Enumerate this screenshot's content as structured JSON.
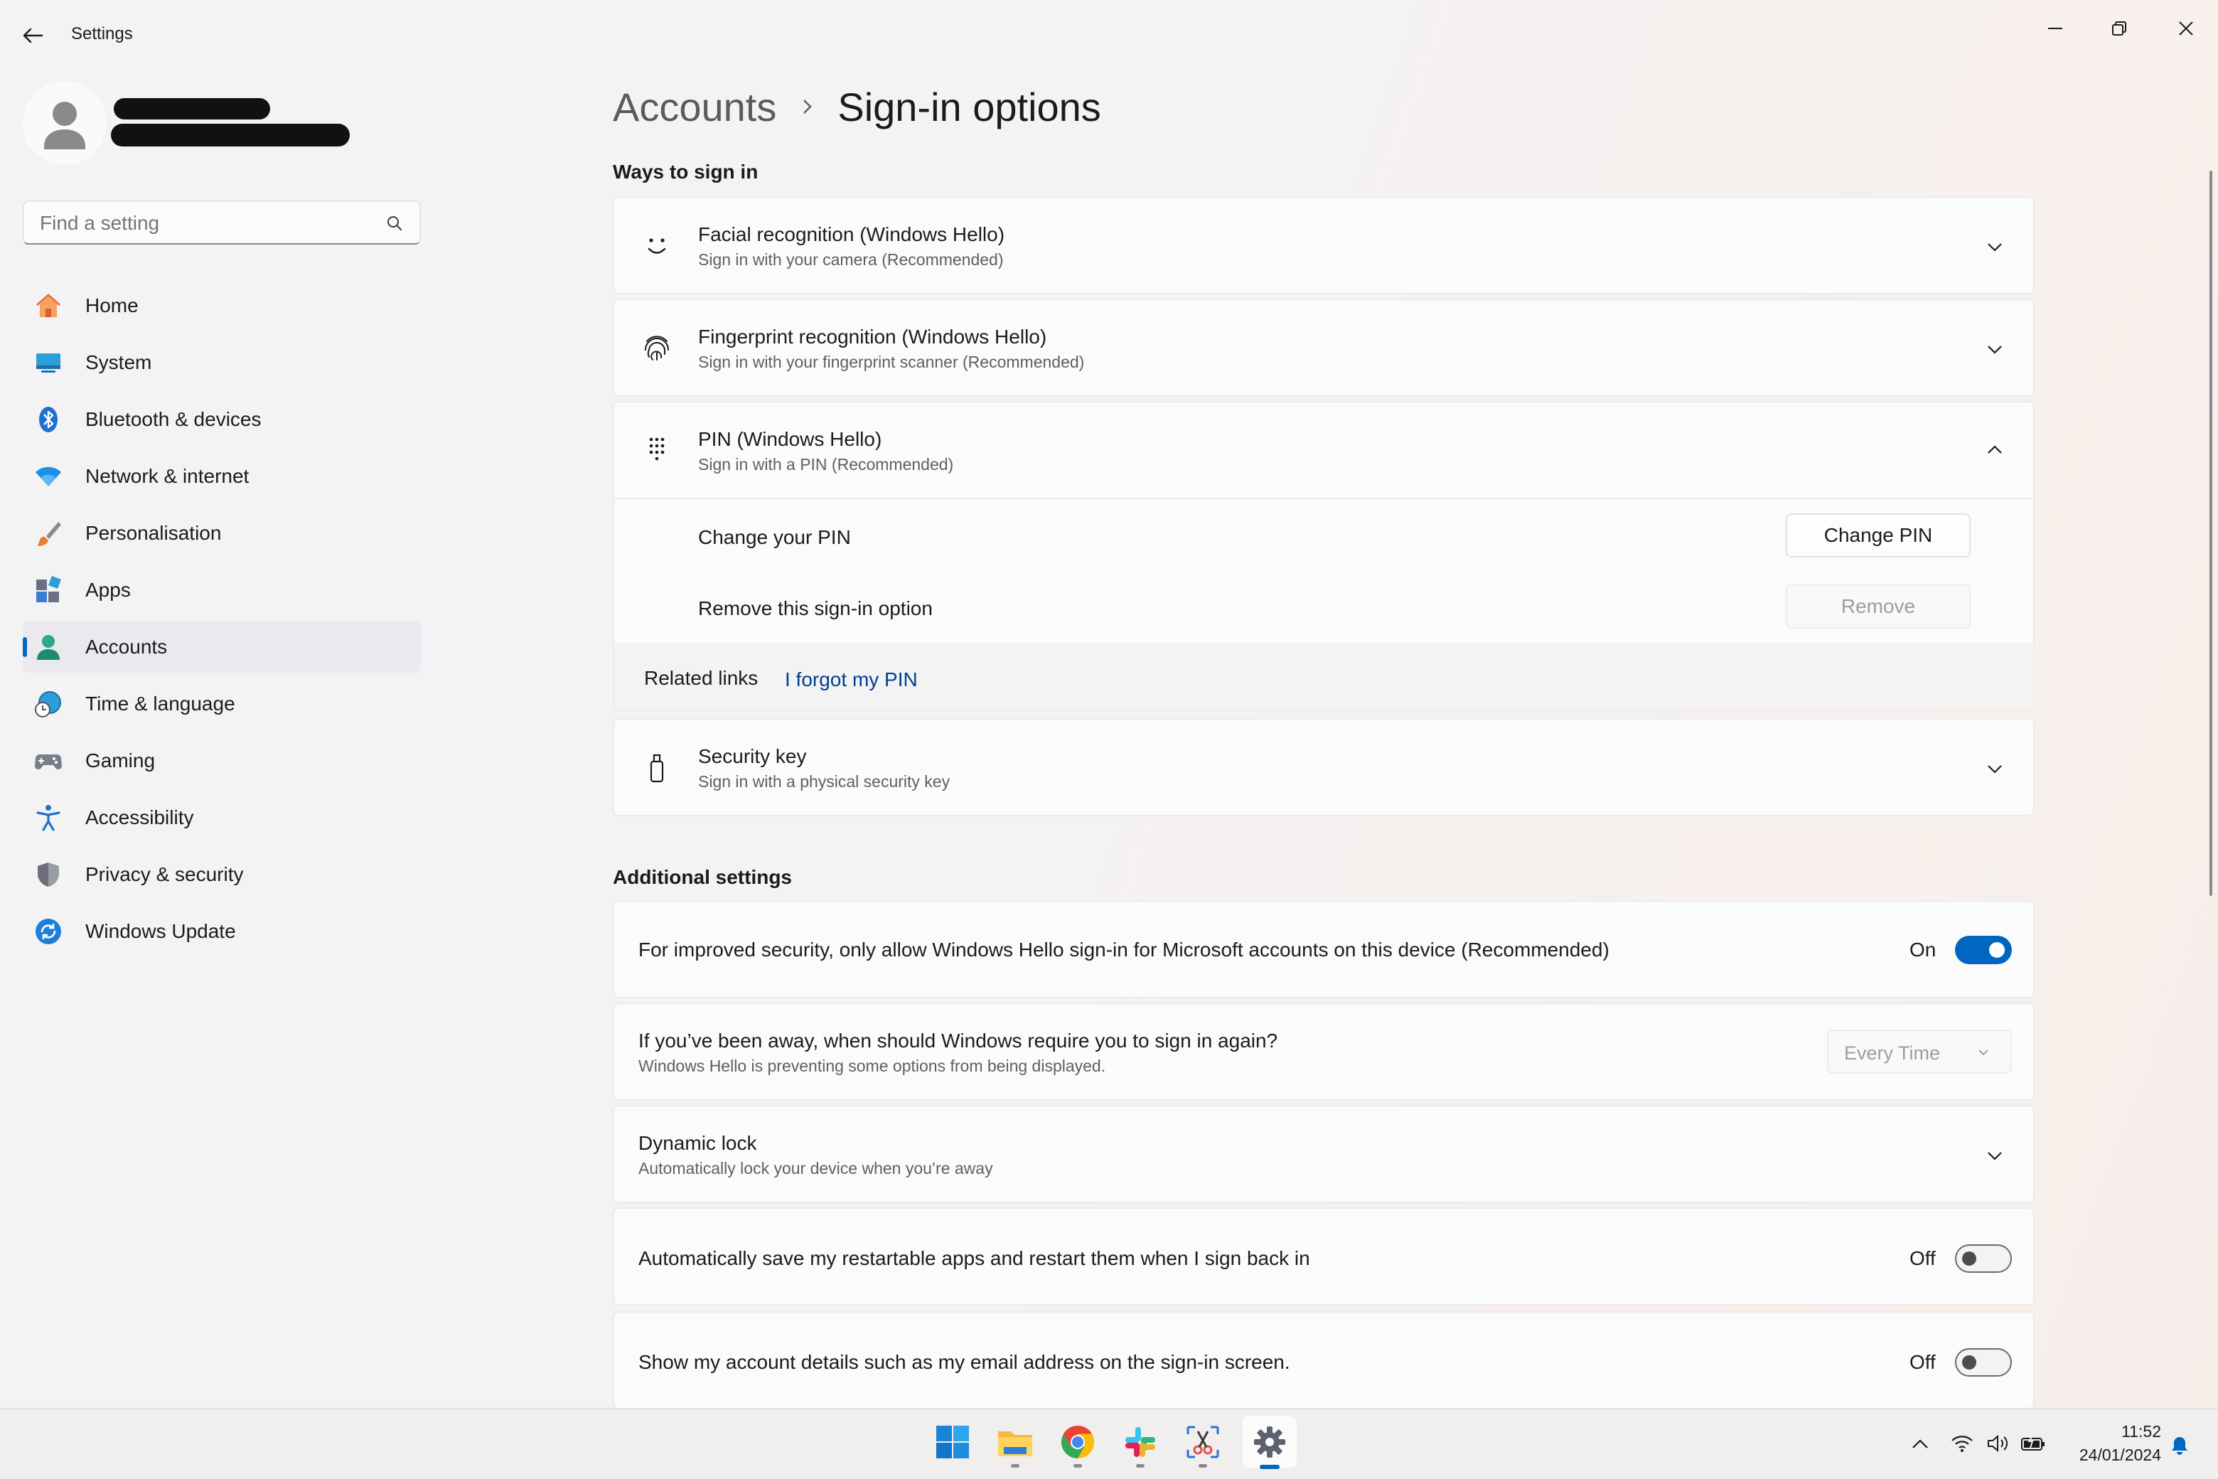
{
  "window": {
    "title": "Settings",
    "controls": [
      "minimize",
      "restore",
      "close"
    ]
  },
  "search": {
    "placeholder": "Find a setting"
  },
  "nav": [
    {
      "label": "Home",
      "icon": "home-icon"
    },
    {
      "label": "System",
      "icon": "system-icon"
    },
    {
      "label": "Bluetooth & devices",
      "icon": "bluetooth-icon"
    },
    {
      "label": "Network & internet",
      "icon": "wifi-icon"
    },
    {
      "label": "Personalisation",
      "icon": "paintbrush-icon"
    },
    {
      "label": "Apps",
      "icon": "apps-icon"
    },
    {
      "label": "Accounts",
      "icon": "accounts-icon",
      "active": true
    },
    {
      "label": "Time & language",
      "icon": "clock-globe-icon"
    },
    {
      "label": "Gaming",
      "icon": "gamepad-icon"
    },
    {
      "label": "Accessibility",
      "icon": "accessibility-icon"
    },
    {
      "label": "Privacy & security",
      "icon": "shield-icon"
    },
    {
      "label": "Windows Update",
      "icon": "update-icon"
    }
  ],
  "breadcrumb": {
    "parent": "Accounts",
    "separator": "›",
    "current": "Sign-in options"
  },
  "ways": {
    "heading": "Ways to sign in",
    "facial": {
      "title": "Facial recognition (Windows Hello)",
      "sub": "Sign in with your camera (Recommended)"
    },
    "fingerprint": {
      "title": "Fingerprint recognition (Windows Hello)",
      "sub": "Sign in with your fingerprint scanner (Recommended)"
    },
    "pin": {
      "title": "PIN (Windows Hello)",
      "sub": "Sign in with a PIN (Recommended)",
      "change_label": "Change your PIN",
      "change_button": "Change PIN",
      "remove_label": "Remove this sign-in option",
      "remove_button": "Remove",
      "related_label": "Related links",
      "forgot_link": "I forgot my PIN"
    },
    "security_key": {
      "title": "Security key",
      "sub": "Sign in with a physical security key"
    }
  },
  "additional": {
    "heading": "Additional settings",
    "hello_only": {
      "title": "For improved security, only allow Windows Hello sign-in for Microsoft accounts on this device (Recommended)",
      "state": "On",
      "on": true
    },
    "away": {
      "title": "If you’ve been away, when should Windows require you to sign in again?",
      "sub": "Windows Hello is preventing some options from being displayed.",
      "selected": "Every Time"
    },
    "dynamic_lock": {
      "title": "Dynamic lock",
      "sub": "Automatically lock your device when you’re away"
    },
    "restart_apps": {
      "title": "Automatically save my restartable apps and restart them when I sign back in",
      "state": "Off",
      "on": false
    },
    "account_details": {
      "title": "Show my account details such as my email address on the sign-in screen.",
      "state": "Off",
      "on": false
    }
  },
  "taskbar": {
    "apps": [
      "windows-start-icon",
      "file-explorer-icon",
      "chrome-icon",
      "slack-icon",
      "snipping-tool-icon",
      "settings-icon"
    ],
    "time": "11:52",
    "date": "24/01/2024"
  },
  "colors": {
    "accent": "#0067c0",
    "link": "#003e92"
  }
}
